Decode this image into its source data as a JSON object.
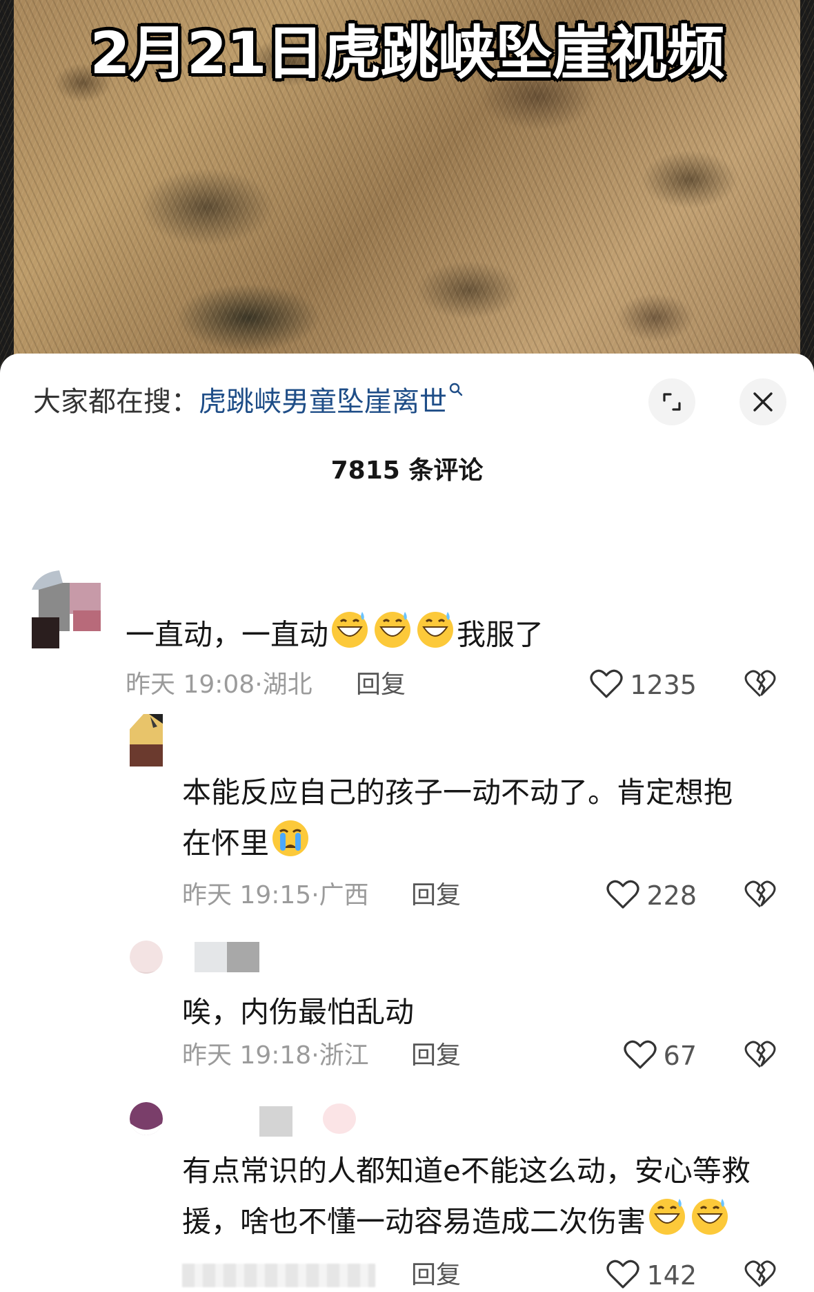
{
  "video": {
    "title": "2月21日虎跳峡坠崖视频"
  },
  "header": {
    "search_prefix": "大家都在搜：",
    "search_term": "虎跳峡男童坠崖离世",
    "search_icon": "magnifier-icon",
    "expand_icon": "expand-icon",
    "close_icon": "close-icon"
  },
  "comment_count": "7815 条评论",
  "comments": [
    {
      "text": "一直动，一直动",
      "emoji": "grinning-sweat-emoji",
      "text_suffix": "我服了",
      "time": "昨天 19:08",
      "location": "湖北",
      "reply_label": "回复",
      "likes": "1235"
    },
    {
      "text_line1": "本能反应自己的孩子一动不动了。肯定想抱",
      "text_line2": "在怀里",
      "emoji": "crying-emoji",
      "time": "昨天 19:15",
      "location": "广西",
      "reply_label": "回复",
      "likes": "228"
    },
    {
      "text": "唉，内伤最怕乱动",
      "time": "昨天 19:18",
      "location": "浙江",
      "reply_label": "回复",
      "likes": "67"
    },
    {
      "text_line1": "有点常识的人都知道e不能这么动，安心等救",
      "text_line2": "援，啥也不懂一动容易造成二次伤害",
      "emoji": "grinning-sweat-emoji",
      "reply_label": "回复",
      "likes": "142"
    }
  ],
  "separator": "·",
  "colors": {
    "search_term": "#1e4d87",
    "meta_gray": "#9b9b9b",
    "text": "#161616"
  }
}
